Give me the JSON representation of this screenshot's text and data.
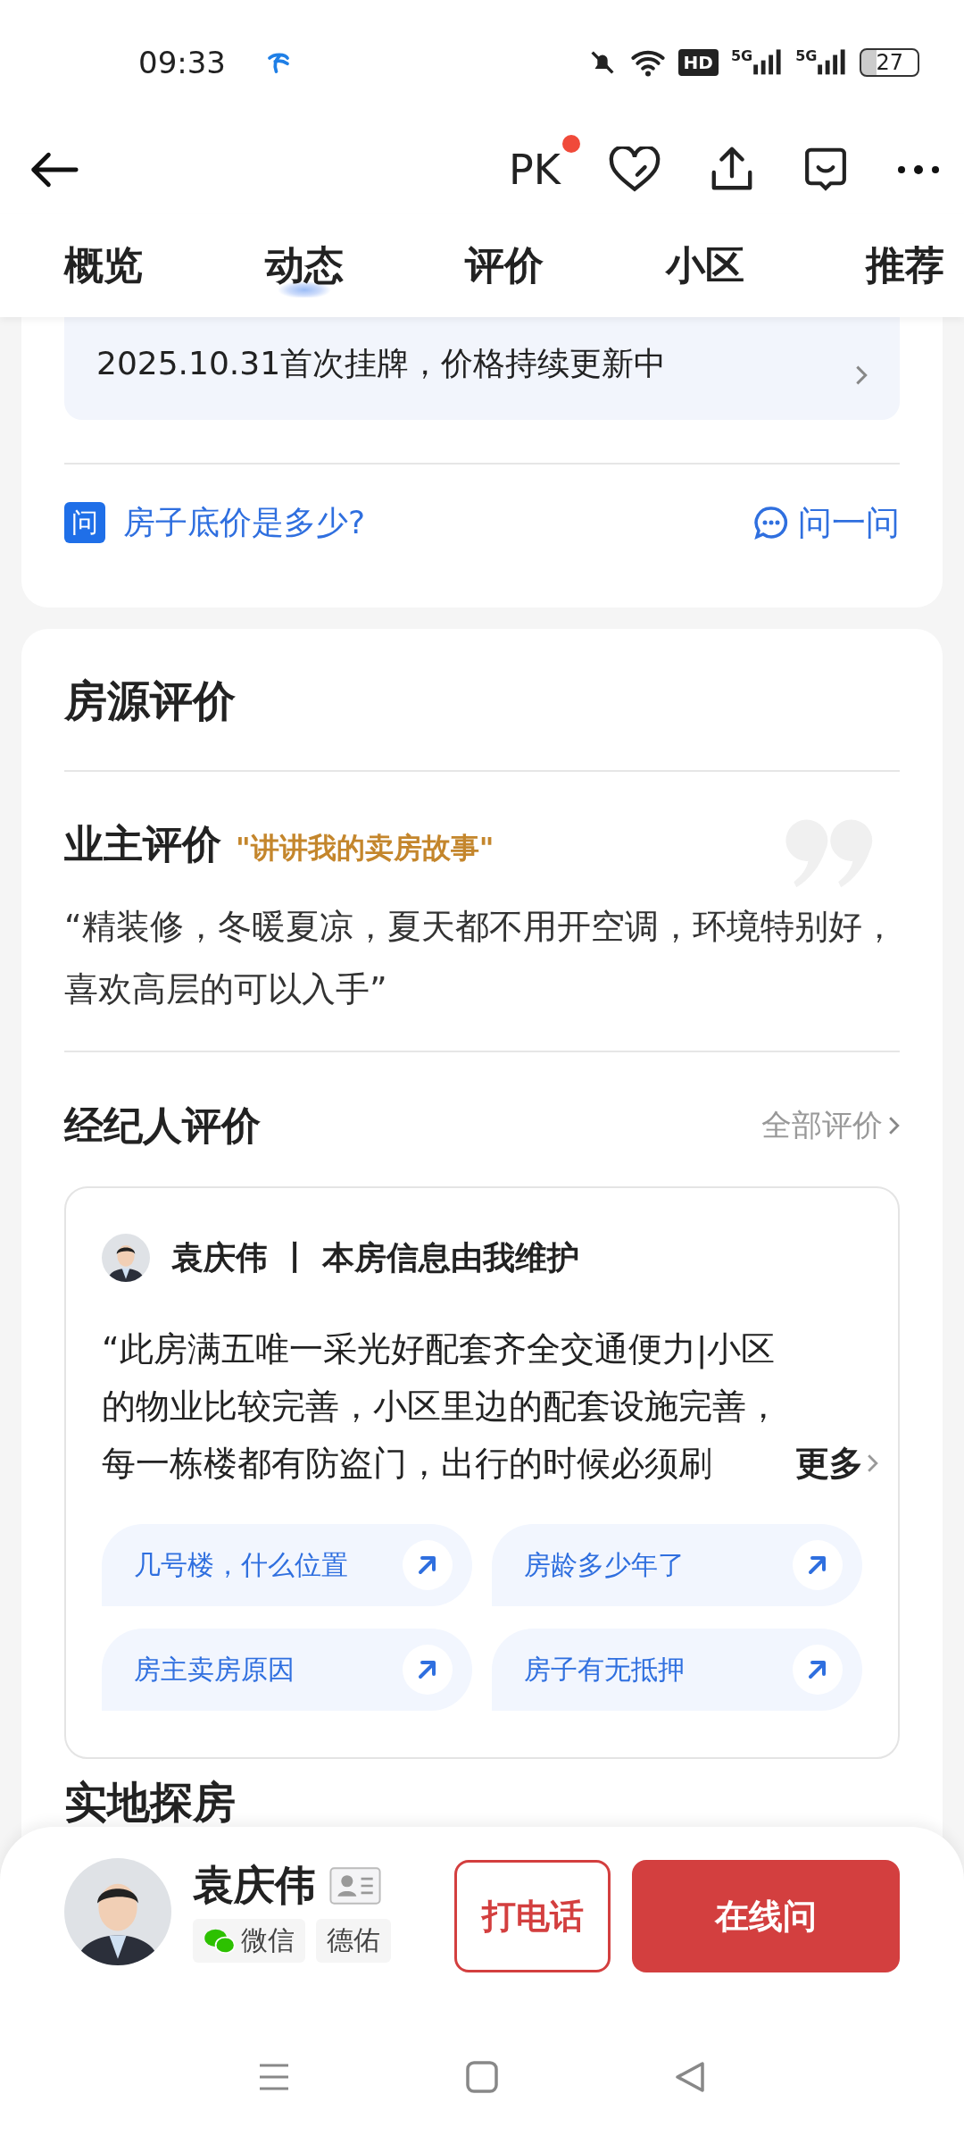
{
  "status_bar": {
    "time": "09:33",
    "hd": "HD",
    "signal_labels": [
      "5G",
      "5G"
    ],
    "battery": "27"
  },
  "header": {
    "pk": "PK",
    "pk_badge": true
  },
  "tabs": [
    {
      "label": "概览",
      "selected": false
    },
    {
      "label": "动态",
      "selected": true
    },
    {
      "label": "评价",
      "selected": false
    },
    {
      "label": "小区",
      "selected": false
    },
    {
      "label": "推荐",
      "selected": false
    }
  ],
  "listing_banner": "2025.10.31首次挂牌，价格持续更新中",
  "question": {
    "icon": "问",
    "text": "房子底价是多少?",
    "action": "问一问"
  },
  "review_section": {
    "title": "房源评价",
    "owner": {
      "title": "业主评价",
      "subtitle": "\"讲讲我的卖房故事\"",
      "quote": "“精装修，冬暖夏凉，夏天都不用开空调，环境特别好，喜欢高层的可以入手”"
    },
    "agent": {
      "title": "经纪人评价",
      "all_link": "全部评价",
      "card": {
        "name": "袁庆伟",
        "separator": "丨",
        "note": "本房信息由我维护",
        "quote": "“此房满五唯一采光好配套齐全交通便力|小区的物业比较完善，小区里边的配套设施完善，每一栋楼都有防盗门，出行的时候必须刷",
        "more": "更多",
        "chips": [
          "几号楼，什么位置",
          "房龄多少年了",
          "房主卖房原因",
          "房子有无抵押"
        ]
      }
    }
  },
  "next_section": {
    "title": "实地探房"
  },
  "bottom_bar": {
    "name": "袁庆伟",
    "tags": [
      {
        "kind": "wechat",
        "label": "微信"
      },
      {
        "kind": "plain",
        "label": "德佑"
      }
    ],
    "call_button": "打电话",
    "chat_button": "在线问"
  }
}
